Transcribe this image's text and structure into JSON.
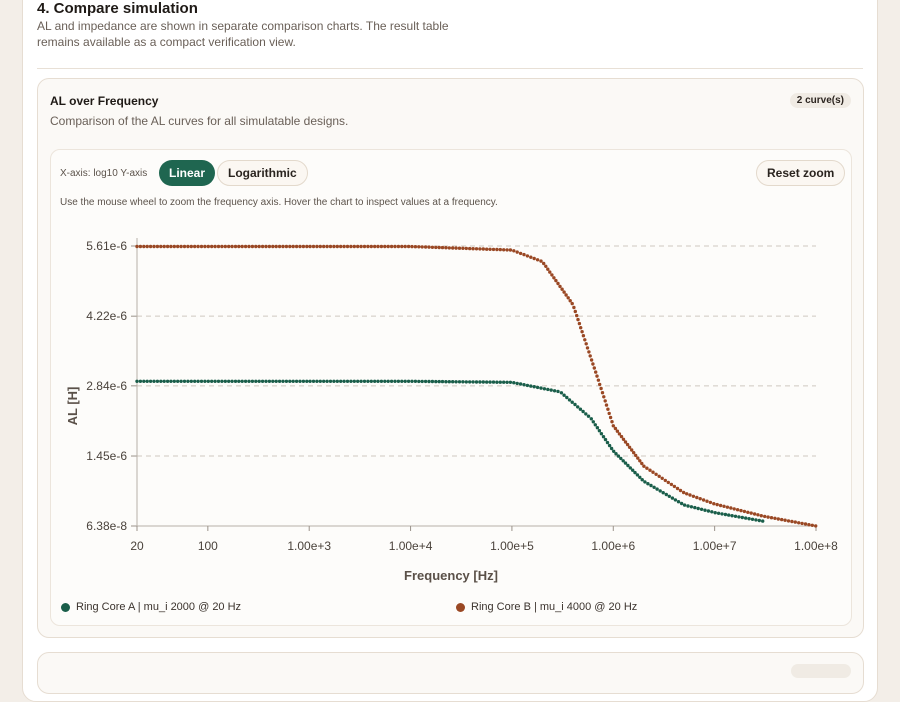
{
  "section": {
    "title": "4. Compare simulation",
    "description": "AL and impedance are shown in separate comparison charts. The result table remains available as a compact verification view."
  },
  "chart_card": {
    "title": "AL over Frequency",
    "subtitle": "Comparison of the AL curves for all simulatable designs.",
    "badge": "2 curve(s)"
  },
  "toolbar": {
    "axis_mode": "X-axis: log10  Y-axis",
    "linear_label": "Linear",
    "log_label": "Logarithmic",
    "reset_label": "Reset zoom",
    "hint": "Use the mouse wheel to zoom the frequency axis. Hover the chart to inspect values at a frequency."
  },
  "colors": {
    "series_a": "#1a5e4a",
    "series_b": "#9a4824",
    "accent": "#1f6650"
  },
  "chart_data": {
    "type": "scatter",
    "xlabel": "Frequency [Hz]",
    "ylabel": "AL [H]",
    "x_scale": "log",
    "y_scale": "linear",
    "xlim": [
      20,
      100000000
    ],
    "ylim": [
      6.38e-08,
      5.61e-06
    ],
    "x_ticks": [
      {
        "value": 20,
        "label": "20"
      },
      {
        "value": 100,
        "label": "100"
      },
      {
        "value": 1000,
        "label": "1.00e+3"
      },
      {
        "value": 10000,
        "label": "1.00e+4"
      },
      {
        "value": 100000,
        "label": "1.00e+5"
      },
      {
        "value": 1000000,
        "label": "1.00e+6"
      },
      {
        "value": 10000000,
        "label": "1.00e+7"
      },
      {
        "value": 100000000,
        "label": "1.00e+8"
      }
    ],
    "y_ticks": [
      {
        "value": 5.61e-06,
        "label": "5.61e-6"
      },
      {
        "value": 4.22e-06,
        "label": "4.22e-6"
      },
      {
        "value": 2.84e-06,
        "label": "2.84e-6"
      },
      {
        "value": 1.45e-06,
        "label": "1.45e-6"
      },
      {
        "value": 6.38e-08,
        "label": "6.38e-8"
      }
    ],
    "grid": "horizontal dashed",
    "legend_position": "bottom",
    "series": [
      {
        "name": "Ring Core A | mu_i 2000 @ 20 Hz",
        "x": [
          20,
          100,
          1000,
          10000,
          100000,
          300000,
          600000,
          1000000,
          2000000,
          5000000,
          10000000,
          30000000
        ],
        "values": [
          2.93e-06,
          2.93e-06,
          2.93e-06,
          2.93e-06,
          2.91e-06,
          2.72e-06,
          2.2e-06,
          1.55e-06,
          9.5e-07,
          4.8e-07,
          3.3e-07,
          1.6e-07
        ]
      },
      {
        "name": "Ring Core B | mu_i 4000 @ 20 Hz",
        "x": [
          20,
          100,
          1000,
          10000,
          100000,
          200000,
          400000,
          700000,
          1000000,
          2000000,
          5000000,
          10000000,
          30000000,
          100000000
        ],
        "values": [
          5.6e-06,
          5.6e-06,
          5.6e-06,
          5.6e-06,
          5.53e-06,
          5.3e-06,
          4.45e-06,
          3e-06,
          2.05e-06,
          1.25e-06,
          7.2e-07,
          5e-07,
          2.6e-07,
          6.38e-08
        ]
      }
    ]
  }
}
